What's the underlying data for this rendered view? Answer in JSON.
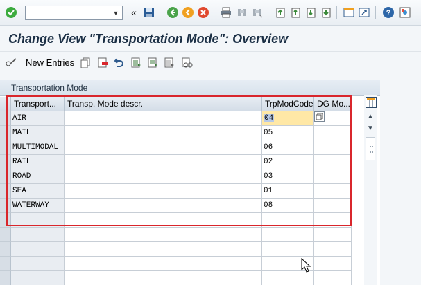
{
  "toolbar": {
    "command_value": "",
    "icons": [
      "check-icon",
      "back-double-icon",
      "save-icon",
      "back-icon",
      "exit-icon",
      "cancel-icon",
      "print-icon",
      "find-icon",
      "find-next-icon",
      "first-page-icon",
      "previous-page-icon",
      "next-page-icon",
      "last-page-icon",
      "new-session-icon",
      "shortcut-icon",
      "help-icon",
      "customize-icon"
    ]
  },
  "header": {
    "title": "Change View \"Transportation Mode\": Overview"
  },
  "app_toolbar": {
    "new_entries_label": "New Entries"
  },
  "table": {
    "caption": "Transportation Mode",
    "columns": [
      "Transport...",
      "Transp. Mode descr.",
      "TrpModCode",
      "DG Mo..."
    ],
    "rows": [
      {
        "mode": "AIR",
        "descr": "",
        "code": "04",
        "dg": ""
      },
      {
        "mode": "MAIL",
        "descr": "",
        "code": "05",
        "dg": ""
      },
      {
        "mode": "MULTIMODAL",
        "descr": "",
        "code": "06",
        "dg": ""
      },
      {
        "mode": "RAIL",
        "descr": "",
        "code": "02",
        "dg": ""
      },
      {
        "mode": "ROAD",
        "descr": "",
        "code": "03",
        "dg": ""
      },
      {
        "mode": "SEA",
        "descr": "",
        "code": "01",
        "dg": ""
      },
      {
        "mode": "WATERWAY",
        "descr": "",
        "code": "08",
        "dg": ""
      }
    ],
    "selected": {
      "row": 0,
      "column": "TrpModCode"
    }
  },
  "colors": {
    "highlight_border": "#d9262c",
    "selected_cell": "#ffe8a6",
    "title_text": "#1b2f45"
  }
}
